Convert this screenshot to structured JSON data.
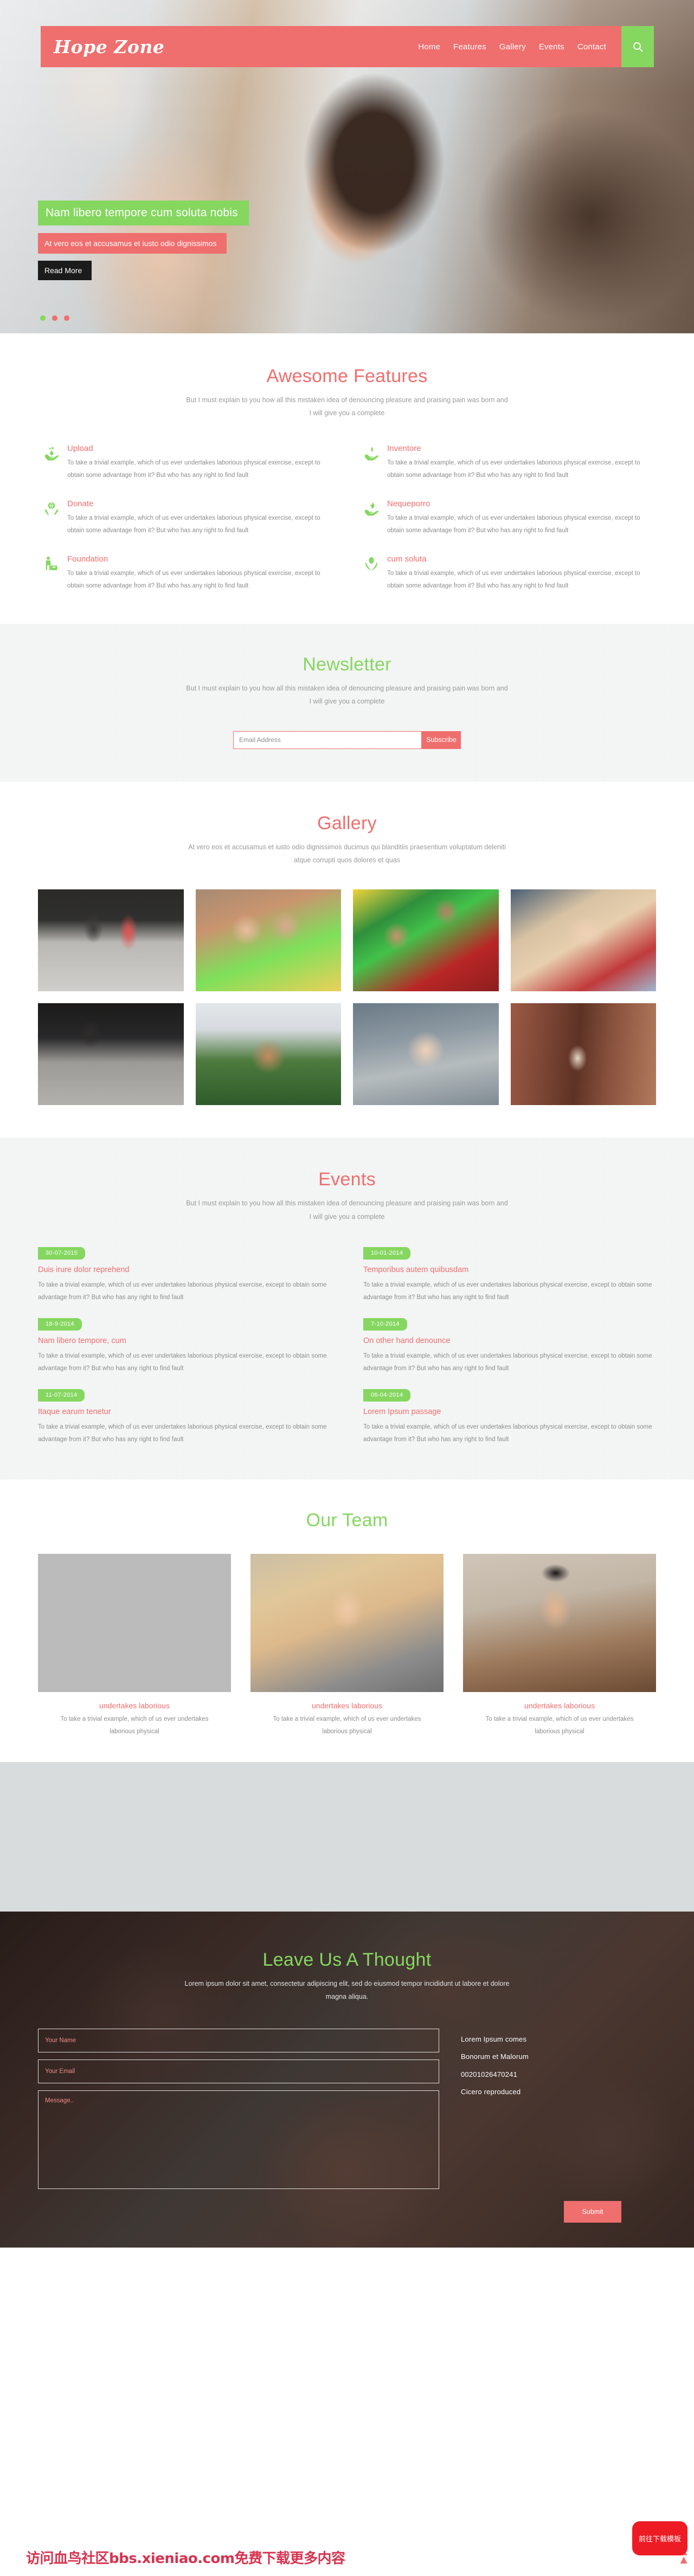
{
  "nav": {
    "brand": "Hope Zone",
    "links": [
      {
        "label": "Home"
      },
      {
        "label": "Features"
      },
      {
        "label": "Gallery"
      },
      {
        "label": "Events"
      },
      {
        "label": "Contact"
      }
    ],
    "search_icon": "search-icon"
  },
  "hero": {
    "title": "Nam libero tempore cum soluta nobis",
    "subtitle": "At vero eos et accusamus et iusto odio dignissimos",
    "button": "Read More",
    "slides": 3,
    "active_slide": 1
  },
  "features": {
    "title": "Awesome Features",
    "subtitle": "But I must explain to you how all this mistaken idea of denouncing pleasure and praising pain was born and I will give you a complete",
    "items": [
      {
        "icon": "sprout-in-hand-icon",
        "title": "Upload",
        "desc": "To take a trivial example, which of us ever undertakes laborious physical exercise, except to obtain some advantage from it? But who has any right to find fault"
      },
      {
        "icon": "leaf-in-hand-icon",
        "title": "Inventore",
        "desc": "To take a trivial example, which of us ever undertakes laborious physical exercise, except to obtain some advantage from it? But who has any right to find fault"
      },
      {
        "icon": "globe-in-hands-icon",
        "title": "Donate",
        "desc": "To take a trivial example, which of us ever undertakes laborious physical exercise, except to obtain some advantage from it? But who has any right to find fault"
      },
      {
        "icon": "dove-in-hand-icon",
        "title": "Nequeporro",
        "desc": "To take a trivial example, which of us ever undertakes laborious physical exercise, except to obtain some advantage from it? But who has any right to find fault"
      },
      {
        "icon": "donation-box-person-icon",
        "title": "Foundation",
        "desc": "To take a trivial example, which of us ever undertakes laborious physical exercise, except to obtain some advantage from it? But who has any right to find fault"
      },
      {
        "icon": "seed-in-hands-icon",
        "title": "cum soluta",
        "desc": "To take a trivial example, which of us ever undertakes laborious physical exercise, except to obtain some advantage from it? But who has any right to find fault"
      }
    ]
  },
  "newsletter": {
    "title": "Newsletter",
    "subtitle": "But I must explain to you how all this mistaken idea of denouncing pleasure and praising pain was born and I will give you a complete",
    "email_placeholder": "Email Address",
    "email_value": "",
    "subscribe_label": "Subscribe"
  },
  "gallery": {
    "title": "Gallery",
    "subtitle": "At vero eos et accusamus et iusto odio dignissimos ducimus qui blanditiis praesentium voluptatum deleniti atque corrupti quos dolores et quas",
    "items": [
      {
        "alt": "two-children-walking-on-path"
      },
      {
        "alt": "two-girls-hugging"
      },
      {
        "alt": "three-boys-portrait"
      },
      {
        "alt": "baby-with-straw-hat"
      },
      {
        "alt": "children-night-scene"
      },
      {
        "alt": "boy-in-field"
      },
      {
        "alt": "child-with-grey-hair"
      },
      {
        "alt": "children-on-doorstep"
      }
    ]
  },
  "events": {
    "title": "Events",
    "subtitle": "But I must explain to you how all this mistaken idea of denouncing pleasure and praising pain was born and I will give you a complete",
    "items": [
      {
        "date": "30-07-2015",
        "title": "Duis irure dolor reprehend",
        "desc": "To take a trivial example, which of us ever undertakes laborious physical exercise, except to obtain some advantage from it? But who has any right to find fault"
      },
      {
        "date": "10-01-2014",
        "title": "Temporibus autem quibusdam",
        "desc": "To take a trivial example, which of us ever undertakes laborious physical exercise, except to obtain some advantage from it? But who has any right to find fault"
      },
      {
        "date": "18-9-2014",
        "title": "Nam libero tempore, cum",
        "desc": "To take a trivial example, which of us ever undertakes laborious physical exercise, except to obtain some advantage from it? But who has any right to find fault"
      },
      {
        "date": "7-10-2014",
        "title": "On other hand denounce",
        "desc": "To take a trivial example, which of us ever undertakes laborious physical exercise, except to obtain some advantage from it? But who has any right to find fault"
      },
      {
        "date": "11-07-2014",
        "title": "Itaque earum tenetur",
        "desc": "To take a trivial example, which of us ever undertakes laborious physical exercise, except to obtain some advantage from it? But who has any right to find fault"
      },
      {
        "date": "06-04-2014",
        "title": "Lorem Ipsum passage",
        "desc": "To take a trivial example, which of us ever undertakes laborious physical exercise, except to obtain some advantage from it? But who has any right to find fault"
      }
    ]
  },
  "team": {
    "title": "Our Team",
    "members": [
      {
        "photo_alt": "man-in-blue-suit",
        "name": "undertakes laborious",
        "desc": "To take a trivial example, which of us ever undertakes laborious physical"
      },
      {
        "photo_alt": "smiling-blonde-woman",
        "name": "undertakes laborious",
        "desc": "To take a trivial example, which of us ever undertakes laborious physical"
      },
      {
        "photo_alt": "man-in-brown-jacket",
        "name": "undertakes laborious",
        "desc": "To take a trivial example, which of us ever undertakes laborious physical"
      }
    ]
  },
  "contact": {
    "title": "Leave Us A Thought",
    "subtitle": "Lorem ipsum dolor sit amet, consectetur adipiscing elit, sed do eiusmod tempor incididunt ut labore et dolore magna aliqua.",
    "name_placeholder": "Your Name",
    "name_value": "",
    "email_placeholder": "Your Email",
    "email_value": "",
    "message_placeholder": "Message..",
    "message_value": "",
    "submit_label": "Submit",
    "info": [
      "Lorem Ipsum comes",
      "Bonorum et Malorum",
      "00201026470241",
      "Cicero reproduced"
    ]
  },
  "overlay": {
    "watermark": "访问血鸟社区bbs.xieniao.com免费下载更多内容",
    "download_badge": "前往下载模板",
    "back_to_top_icon": "chevron-up-double-icon"
  },
  "colors": {
    "brand_red": "#ef6e6e",
    "brand_green": "#85d760",
    "text_grey": "#8d8d8d",
    "dark": "#1b1b1b"
  }
}
